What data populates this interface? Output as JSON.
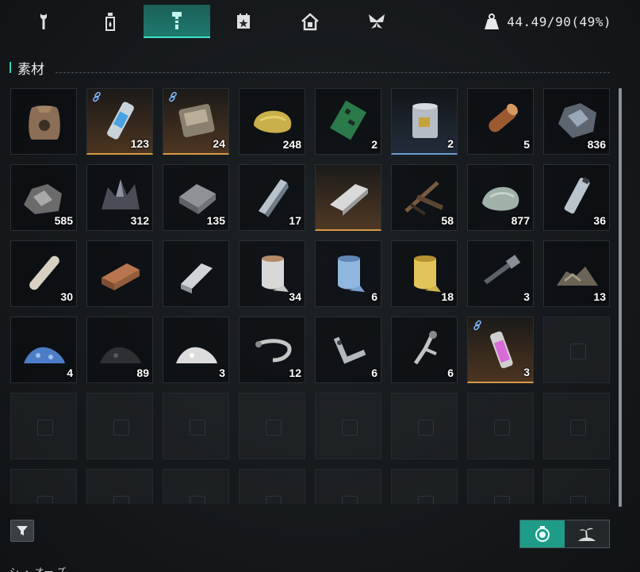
{
  "tabs": [
    {
      "icon": "wrench-icon",
      "active": false
    },
    {
      "icon": "bottle-icon",
      "active": false
    },
    {
      "icon": "bolt-icon",
      "active": true
    },
    {
      "icon": "calendar-star-icon",
      "active": false
    },
    {
      "icon": "house-icon",
      "active": false
    },
    {
      "icon": "butterfly-icon",
      "active": false
    }
  ],
  "weight": {
    "icon": "weight-icon",
    "text": "44.49/90(49%)"
  },
  "section": {
    "title": "素材"
  },
  "items": [
    {
      "icon": "sack-icon",
      "qty": "",
      "rarity": "normal",
      "linked": false
    },
    {
      "icon": "capsule-icon",
      "qty": "123",
      "rarity": "rare",
      "linked": true
    },
    {
      "icon": "device-icon",
      "qty": "24",
      "rarity": "rare",
      "linked": true
    },
    {
      "icon": "sulfur-rock-icon",
      "qty": "248",
      "rarity": "normal",
      "linked": false
    },
    {
      "icon": "circuit-board-icon",
      "qty": "2",
      "rarity": "normal",
      "linked": false
    },
    {
      "icon": "paint-can-icon",
      "qty": "2",
      "rarity": "blue",
      "linked": false
    },
    {
      "icon": "wood-log-icon",
      "qty": "5",
      "rarity": "normal",
      "linked": false
    },
    {
      "icon": "dark-ore-icon",
      "qty": "836",
      "rarity": "normal",
      "linked": false
    },
    {
      "icon": "gray-ore-icon",
      "qty": "585",
      "rarity": "normal",
      "linked": false
    },
    {
      "icon": "crystal-ore-icon",
      "qty": "312",
      "rarity": "normal",
      "linked": false
    },
    {
      "icon": "iron-ingot-icon",
      "qty": "135",
      "rarity": "normal",
      "linked": false
    },
    {
      "icon": "steel-ingot-icon",
      "qty": "17",
      "rarity": "normal",
      "linked": false
    },
    {
      "icon": "silver-ingot-icon",
      "qty": "",
      "rarity": "rare",
      "linked": false
    },
    {
      "icon": "scrap-icon",
      "qty": "58",
      "rarity": "normal",
      "linked": false
    },
    {
      "icon": "stone-icon",
      "qty": "877",
      "rarity": "normal",
      "linked": false
    },
    {
      "icon": "tube-icon",
      "qty": "36",
      "rarity": "normal",
      "linked": false
    },
    {
      "icon": "pipe-icon",
      "qty": "30",
      "rarity": "normal",
      "linked": false
    },
    {
      "icon": "brick-icon",
      "qty": "",
      "rarity": "normal",
      "linked": false
    },
    {
      "icon": "metal-bar-icon",
      "qty": "",
      "rarity": "normal",
      "linked": false
    },
    {
      "icon": "fabric-roll-white-icon",
      "qty": "34",
      "rarity": "normal",
      "linked": false
    },
    {
      "icon": "fabric-roll-blue-icon",
      "qty": "6",
      "rarity": "normal",
      "linked": false
    },
    {
      "icon": "fabric-roll-yellow-icon",
      "qty": "18",
      "rarity": "normal",
      "linked": false
    },
    {
      "icon": "bolt-screw-icon",
      "qty": "3",
      "rarity": "normal",
      "linked": false
    },
    {
      "icon": "rubble-icon",
      "qty": "13",
      "rarity": "normal",
      "linked": false
    },
    {
      "icon": "blue-powder-icon",
      "qty": "4",
      "rarity": "normal",
      "linked": false
    },
    {
      "icon": "black-powder-icon",
      "qty": "89",
      "rarity": "normal",
      "linked": false
    },
    {
      "icon": "white-powder-icon",
      "qty": "3",
      "rarity": "normal",
      "linked": false
    },
    {
      "icon": "shackle-icon",
      "qty": "12",
      "rarity": "normal",
      "linked": false
    },
    {
      "icon": "bracket-icon",
      "qty": "6",
      "rarity": "normal",
      "linked": false
    },
    {
      "icon": "clamp-icon",
      "qty": "6",
      "rarity": "normal",
      "linked": false
    },
    {
      "icon": "pink-vial-icon",
      "qty": "3",
      "rarity": "rare",
      "linked": true
    }
  ],
  "empty_slot_count": 17,
  "footer": {
    "filter_icon": "filter-icon",
    "toggle": [
      {
        "icon": "badge-icon",
        "on": true
      },
      {
        "icon": "island-icon",
        "on": false
      }
    ]
  },
  "bottom_text": "シ ・ オー ズ"
}
